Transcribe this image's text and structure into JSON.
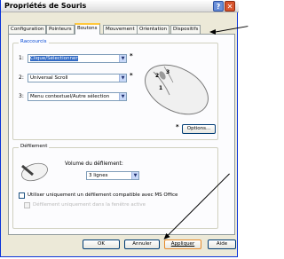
{
  "window": {
    "title": "Propriétés de Souris",
    "help_icon": "question-mark-icon",
    "close_icon": "close-x-icon"
  },
  "tabs": [
    "Configuration",
    "Pointeurs",
    "Boutons",
    "Mouvement",
    "Orientation",
    "Dispositifs"
  ],
  "active_tab": "Boutons",
  "shortcuts": {
    "group_label": "Raccourcis",
    "rows": [
      {
        "num": "1:",
        "value": "Clique/Sélectionner",
        "marker": "*"
      },
      {
        "num": "2:",
        "value": "Universal Scroll",
        "marker": "*"
      },
      {
        "num": "3:",
        "value": "Menu contextuel/Autre sélection",
        "marker": ""
      }
    ],
    "mouse_numbers": [
      "1",
      "2",
      "3"
    ],
    "options_marker": "*",
    "options_button": "Options..."
  },
  "scroll": {
    "group_label": "Défilement",
    "volume_label": "Volume du défilement:",
    "volume_value": "3 lignes",
    "checkbox1_label": "Utiliser uniquement un défilement compatible avec MS Office",
    "checkbox2_label": "Défilement uniquement dans la fenêtre active"
  },
  "buttons": {
    "ok": "OK",
    "cancel": "Annuler",
    "apply": "Appliquer",
    "help": "Aide"
  }
}
